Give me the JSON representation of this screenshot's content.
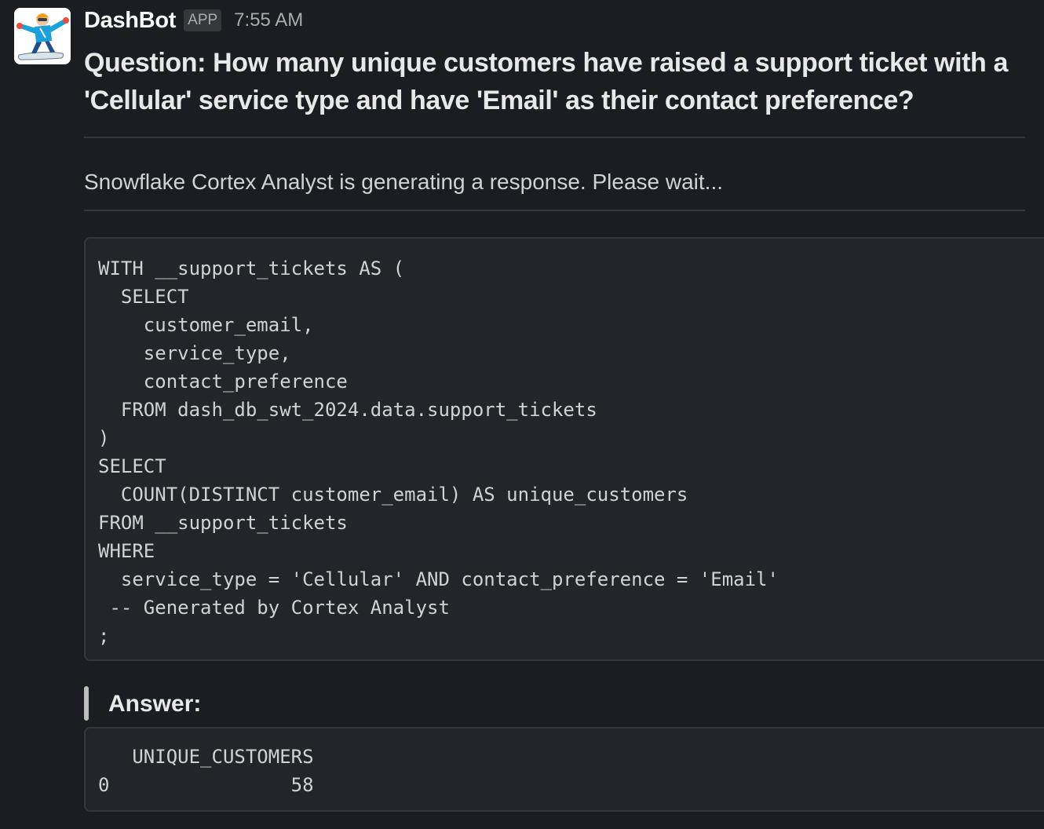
{
  "message": {
    "bot_name": "DashBot",
    "badge": "APP",
    "time": "7:55 AM",
    "avatar_icon": "snowboarder-avatar",
    "question": "Question: How many unique customers have raised a support ticket with a 'Cellular' service type and have 'Email' as their contact preference?",
    "status": "Snowflake Cortex Analyst is generating a response. Please wait...",
    "sql": "WITH __support_tickets AS (\n  SELECT\n    customer_email,\n    service_type,\n    contact_preference\n  FROM dash_db_swt_2024.data.support_tickets\n)\nSELECT\n  COUNT(DISTINCT customer_email) AS unique_customers\nFROM __support_tickets\nWHERE\n  service_type = 'Cellular' AND contact_preference = 'Email'\n -- Generated by Cortex Analyst\n;",
    "answer_label": "Answer:",
    "result": "   UNIQUE_CUSTOMERS\n0                58"
  },
  "colors": {
    "background": "#1a1d21",
    "code_background": "#222529",
    "border": "#35373b",
    "text": "#d1d2d3",
    "muted": "#ababad"
  }
}
